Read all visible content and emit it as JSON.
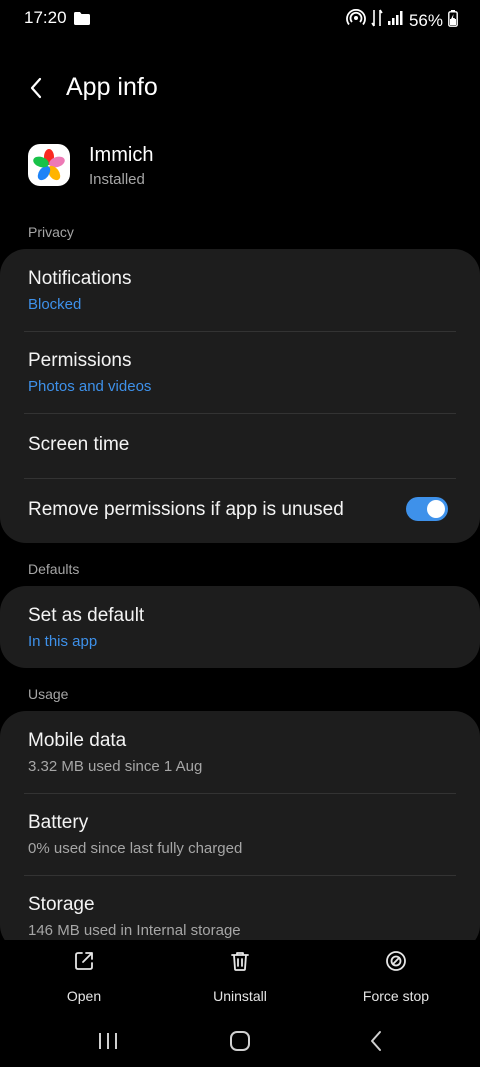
{
  "status_bar": {
    "time": "17:20",
    "battery_percent": "56%"
  },
  "header": {
    "title": "App info"
  },
  "app": {
    "name": "Immich",
    "status": "Installed"
  },
  "sections": {
    "privacy": {
      "label": "Privacy",
      "notifications": {
        "title": "Notifications",
        "subtitle": "Blocked"
      },
      "permissions": {
        "title": "Permissions",
        "subtitle": "Photos and videos"
      },
      "screen_time": {
        "title": "Screen time"
      },
      "remove_permissions": {
        "title": "Remove permissions if app is unused",
        "enabled": true
      }
    },
    "defaults": {
      "label": "Defaults",
      "set_as_default": {
        "title": "Set as default",
        "subtitle": "In this app"
      }
    },
    "usage": {
      "label": "Usage",
      "mobile_data": {
        "title": "Mobile data",
        "subtitle": "3.32 MB used since 1 Aug"
      },
      "battery": {
        "title": "Battery",
        "subtitle": "0% used since last fully charged"
      },
      "storage": {
        "title": "Storage",
        "subtitle": "146 MB used in Internal storage"
      }
    }
  },
  "actions": {
    "open": "Open",
    "uninstall": "Uninstall",
    "force_stop": "Force stop"
  },
  "colors": {
    "accent": "#3e91ea",
    "card_bg": "#1d1d1d",
    "background": "#000000"
  }
}
